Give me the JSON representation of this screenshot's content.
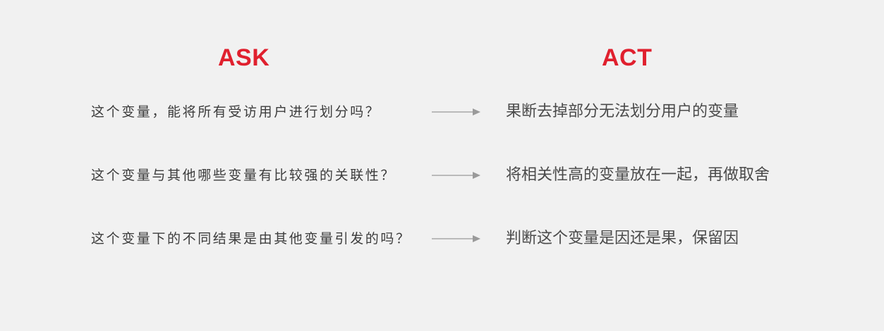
{
  "headers": {
    "ask": "ASK",
    "act": "ACT"
  },
  "rows": [
    {
      "ask": "这个变量，能将所有受访用户进行划分吗？",
      "act": "果断去掉部分无法划分用户的变量"
    },
    {
      "ask": "这个变量与其他哪些变量有比较强的关联性？",
      "act": "将相关性高的变量放在一起，再做取舍"
    },
    {
      "ask": "这个变量下的不同结果是由其他变量引发的吗？",
      "act": "判断这个变量是因还是果，保留因"
    }
  ],
  "colors": {
    "accent": "#e0202e",
    "background": "#f1f1f1",
    "ask_text": "#3c3c3c",
    "act_text": "#4a4a4a",
    "arrow": "#9a9a9a"
  },
  "icons": {
    "arrow": "right-arrow-icon"
  }
}
